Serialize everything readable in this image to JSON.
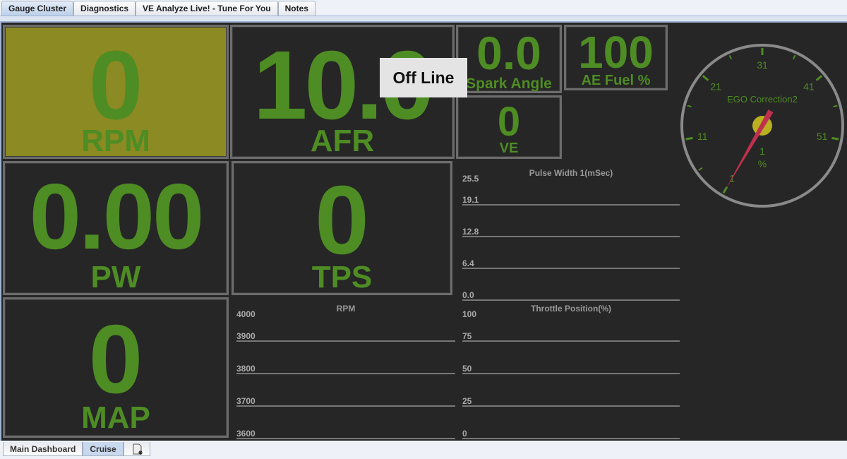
{
  "top_tabs": [
    {
      "label": "Gauge Cluster",
      "selected": true
    },
    {
      "label": "Diagnostics"
    },
    {
      "label": "VE Analyze Live! - Tune For You"
    },
    {
      "label": "Notes"
    }
  ],
  "gauges": {
    "rpm": {
      "value": "0",
      "label": "RPM"
    },
    "afr": {
      "value": "10.0",
      "label": "AFR"
    },
    "spark": {
      "value": "0.0",
      "label": "Spark Angle"
    },
    "aefuel": {
      "value": "100",
      "label": "AE Fuel %"
    },
    "ve": {
      "value": "0",
      "label": "VE"
    },
    "pw": {
      "value": "0.00",
      "label": "PW"
    },
    "tps": {
      "value": "0",
      "label": "TPS"
    },
    "map": {
      "value": "0",
      "label": "MAP"
    }
  },
  "status": {
    "offline": "Off Line"
  },
  "dial": {
    "title": "EGO Correction2",
    "value": "1",
    "unit": "%",
    "ticks": [
      "1",
      "11",
      "21",
      "31",
      "41",
      "51"
    ],
    "needle_value": 1,
    "min": 1,
    "max": 51
  },
  "colors": {
    "green": "#4e8c24",
    "rpm_bg": "#8c8a22",
    "needle": "#c0304e",
    "hub": "#b8b020"
  },
  "strip_charts": {
    "pw": {
      "title": "Pulse Width 1(mSec)",
      "ticks": [
        "25.5",
        "19.1",
        "12.8",
        "6.4",
        "0.0"
      ]
    },
    "rpm": {
      "title": "RPM",
      "ticks": [
        "4000",
        "3900",
        "3800",
        "3700",
        "3600"
      ]
    },
    "tps": {
      "title": "Throttle Position(%)",
      "ticks": [
        "100",
        "75",
        "50",
        "25",
        "0"
      ]
    }
  },
  "bottom_tabs": [
    {
      "label": "Main Dashboard"
    },
    {
      "label": "Cruise",
      "selected": true
    }
  ]
}
